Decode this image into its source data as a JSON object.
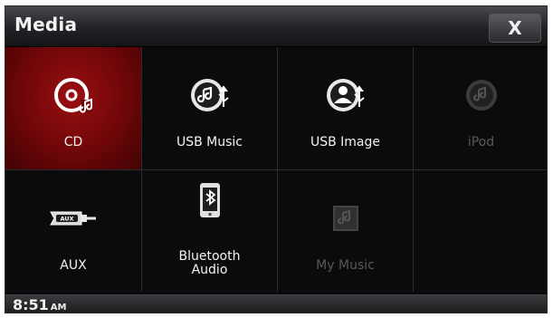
{
  "header": {
    "title": "Media",
    "close_label": "X"
  },
  "tiles": [
    {
      "label": "CD"
    },
    {
      "label": "USB Music"
    },
    {
      "label": "USB Image"
    },
    {
      "label": "iPod"
    },
    {
      "label": "AUX"
    },
    {
      "label": "Bluetooth Audio"
    },
    {
      "label": "My Music"
    }
  ],
  "status": {
    "time": "8:51",
    "ampm": "AM"
  }
}
